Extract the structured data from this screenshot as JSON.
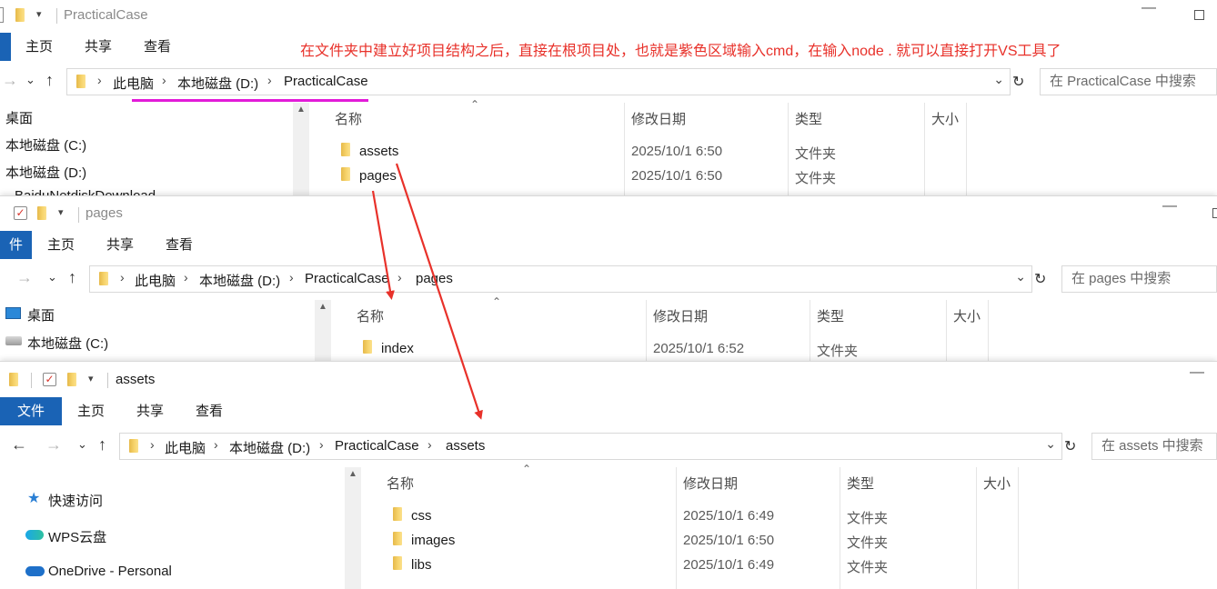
{
  "annotation": {
    "text": "在文件夹中建立好项目结构之后，直接在根项目处，也就是紫色区域输入cmd，在输入node . 就可以直接打开VS工具了",
    "color": "#e8312a",
    "underline_color": "#e21bd8"
  },
  "windows": [
    {
      "title": "PracticalCase",
      "ribbon_tabs": [
        "主页",
        "共享",
        "查看"
      ],
      "breadcrumb": [
        "此电脑",
        "本地磁盘 (D:)",
        "PracticalCase"
      ],
      "search_placeholder": "在 PracticalCase 中搜索",
      "sidebar": [
        "桌面",
        "本地磁盘 (C:)",
        "本地磁盘 (D:)",
        "BaiduNetdiskDownload"
      ],
      "columns": [
        "名称",
        "修改日期",
        "类型",
        "大小"
      ],
      "rows": [
        {
          "name": "assets",
          "date": "2025/10/1 6:50",
          "type": "文件夹"
        },
        {
          "name": "pages",
          "date": "2025/10/1 6:50",
          "type": "文件夹"
        }
      ]
    },
    {
      "title": "pages",
      "ribbon_tabs": [
        "件",
        "主页",
        "共享",
        "查看"
      ],
      "breadcrumb": [
        "此电脑",
        "本地磁盘 (D:)",
        "PracticalCase",
        "pages"
      ],
      "search_placeholder": "在 pages 中搜索",
      "sidebar": [
        "桌面",
        "本地磁盘 (C:)"
      ],
      "columns": [
        "名称",
        "修改日期",
        "类型",
        "大小"
      ],
      "rows": [
        {
          "name": "index",
          "date": "2025/10/1 6:52",
          "type": "文件夹"
        }
      ]
    },
    {
      "title": "assets",
      "ribbon_tabs": [
        "文件",
        "主页",
        "共享",
        "查看"
      ],
      "breadcrumb": [
        "此电脑",
        "本地磁盘 (D:)",
        "PracticalCase",
        "assets"
      ],
      "search_placeholder": "在 assets 中搜索",
      "sidebar": [
        "快速访问",
        "WPS云盘",
        "OneDrive - Personal"
      ],
      "columns": [
        "名称",
        "修改日期",
        "类型",
        "大小"
      ],
      "rows": [
        {
          "name": "css",
          "date": "2025/10/1 6:49",
          "type": "文件夹"
        },
        {
          "name": "images",
          "date": "2025/10/1 6:50",
          "type": "文件夹"
        },
        {
          "name": "libs",
          "date": "2025/10/1 6:49",
          "type": "文件夹"
        }
      ]
    }
  ],
  "icons": {
    "checkbox": "checkbox-icon",
    "folder": "folder-icon",
    "dropdown": "dropdown-arrow-icon",
    "back": "back-arrow-icon",
    "forward": "forward-arrow-icon",
    "up": "up-arrow-icon",
    "refresh": "refresh-icon",
    "minimize": "minimize-icon",
    "maximize": "maximize-icon",
    "pin": "pin-icon",
    "cloud": "cloud-icon",
    "desktop": "desktop-icon",
    "drive": "drive-icon"
  },
  "accent": "#1a63b5"
}
